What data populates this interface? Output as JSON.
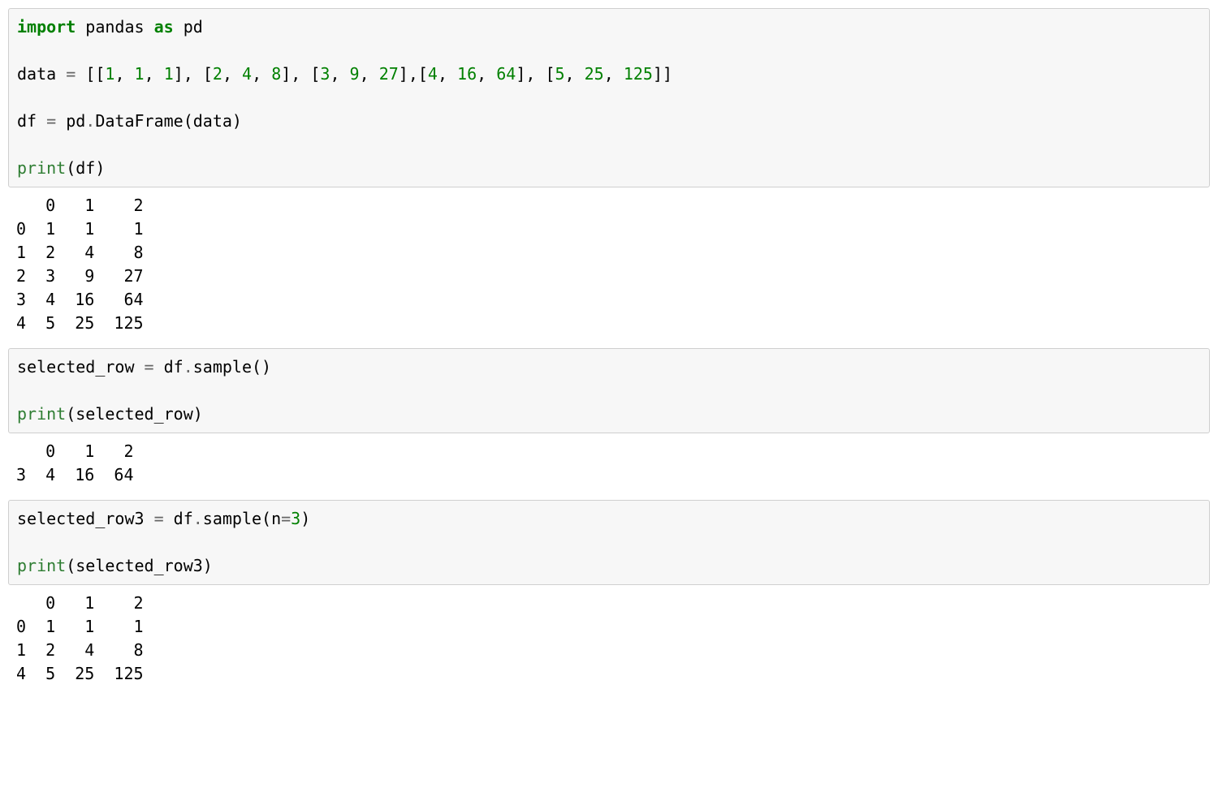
{
  "cell1": {
    "import": "import",
    "pandas": "pandas",
    "as": "as",
    "pd": "pd",
    "data_lhs": "data ",
    "eq": "=",
    "sp": " ",
    "lb": "[[",
    "n1": "1",
    "c": ", ",
    "n1b": "1",
    "n1c": "1",
    "mb": "], [",
    "n2": "2",
    "n4": "4",
    "n8": "8",
    "n3": "3",
    "n9": "9",
    "n27": "27",
    "mb2": "],[",
    "n4b": "4",
    "n16": "16",
    "n64": "64",
    "n5": "5",
    "n25": "25",
    "n125": "125",
    "rb": "]]",
    "df_lhs": "df ",
    "pd_df": " pd",
    "dot": ".",
    "DataFrame": "DataFrame(data)",
    "print": "print",
    "print_arg": "(df)"
  },
  "out1": "   0   1    2\n0  1   1    1\n1  2   4    8\n2  3   9   27\n3  4  16   64\n4  5  25  125",
  "cell2": {
    "lhs": "selected_row ",
    "eq": "=",
    "rhs_pre": " df",
    "dot": ".",
    "sample": "sample()",
    "print": "print",
    "print_arg": "(selected_row)"
  },
  "out2": "   0   1   2\n3  4  16  64",
  "cell3": {
    "lhs": "selected_row3 ",
    "eq": "=",
    "rhs_pre": " df",
    "dot": ".",
    "sample_open": "sample(n",
    "eq2": "=",
    "n3": "3",
    "close": ")",
    "print": "print",
    "print_arg": "(selected_row3)"
  },
  "out3": "   0   1    2\n0  1   1    1\n1  2   4    8\n4  5  25  125"
}
